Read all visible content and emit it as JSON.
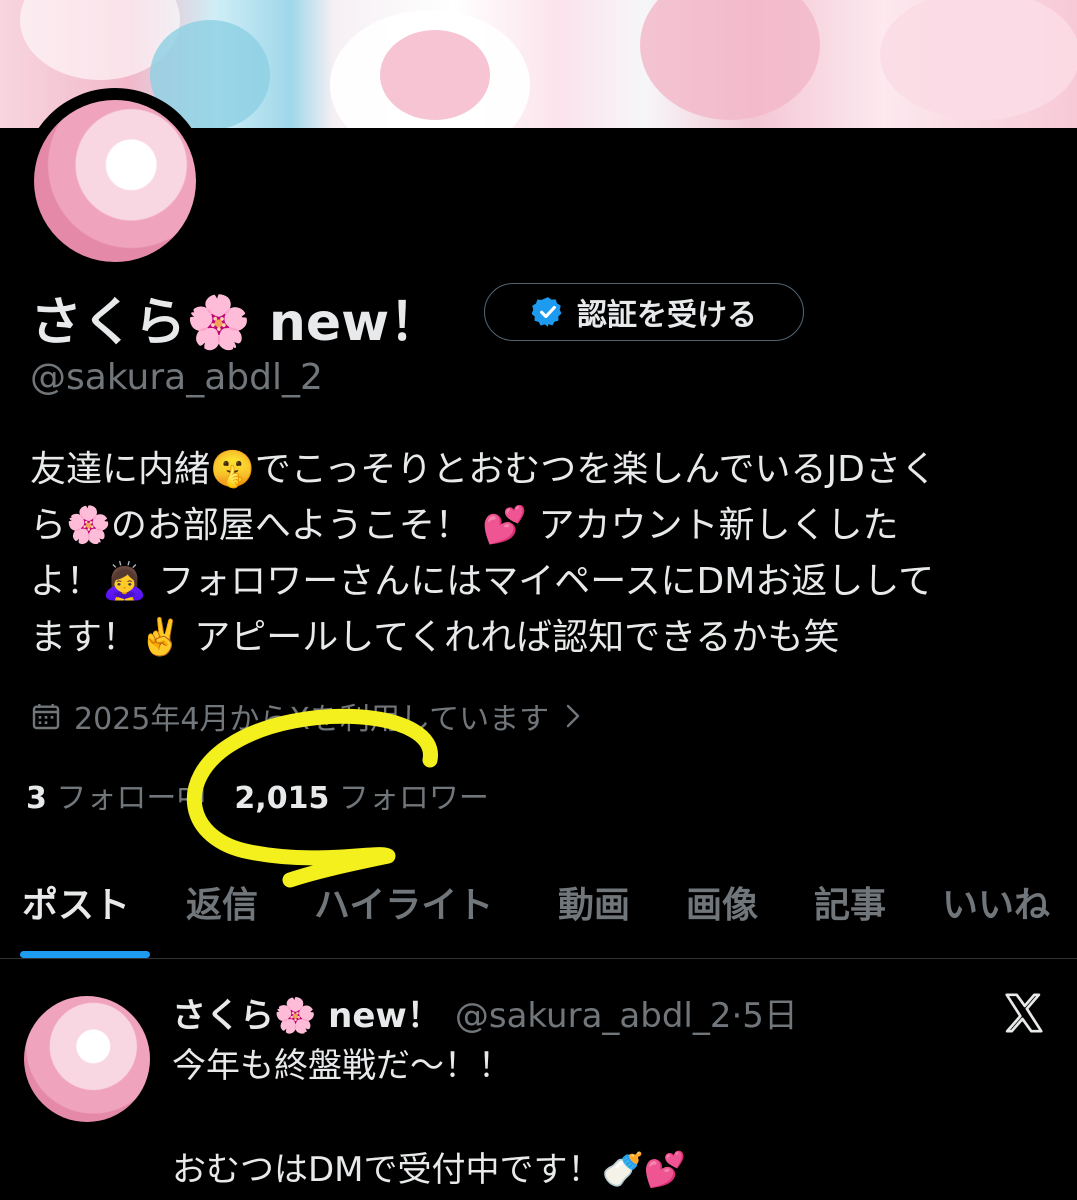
{
  "profile": {
    "display_name": "さくら🌸 new！",
    "verify_button_label": "認証を受ける",
    "handle": "@sakura_abdl_2",
    "bio": "友達に内緒🤫でこっそりとおむつを楽しんでいるJDさく\nら🌸のお部屋へようこそ！ 💕 アカウント新しくした\nよ！🙇‍♀️ フォロワーさんにはマイペースにDMお返しして\nます！✌️ アピールしてくれれば認知できるかも笑",
    "joined": "2025年4月からXを利用しています",
    "following_count": "3",
    "following_label": "フォロー中",
    "followers_count": "2,015",
    "followers_label": "フォロワー"
  },
  "annotation": {
    "color": "#f3f01e"
  },
  "tabs": [
    "ポスト",
    "返信",
    "ハイライト",
    "動画",
    "画像",
    "記事",
    "いいね"
  ],
  "active_tab": "ポスト",
  "post": {
    "author_name": "さくら🌸 new！",
    "meta": "@sakura_abdl_2·5日",
    "text": "今年も終盤戦だ〜！！\n\nおむつはDMで受付中です！🍼💕"
  },
  "colors": {
    "background": "#000000",
    "text": "#e7e9ea",
    "muted": "#71767b",
    "accent": "#1d9bf0"
  },
  "icons": [
    "verified-badge-icon",
    "calendar-icon",
    "chevron-right-icon",
    "x-logo-icon"
  ]
}
